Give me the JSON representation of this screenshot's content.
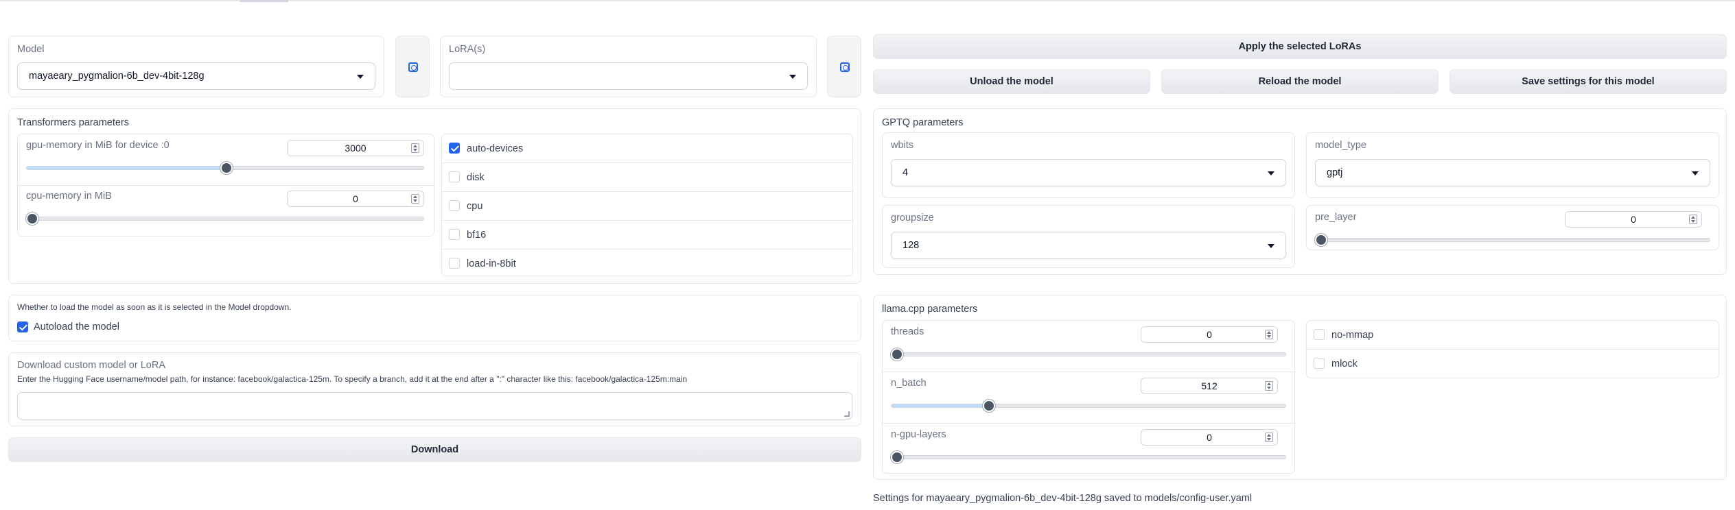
{
  "model": {
    "label": "Model",
    "selected": "mayaeary_pygmalion-6b_dev-4bit-128g"
  },
  "lora": {
    "label": "LoRA(s)",
    "selected": ""
  },
  "buttons": {
    "apply_loras": "Apply the selected LoRAs",
    "unload": "Unload the model",
    "reload": "Reload the model",
    "save_settings": "Save settings for this model",
    "download": "Download"
  },
  "transformers": {
    "title": "Transformers parameters",
    "gpu_memory": {
      "label": "gpu-memory in MiB for device :0",
      "value": "3000",
      "level": 0.5
    },
    "cpu_memory": {
      "label": "cpu-memory in MiB",
      "value": "0",
      "level": 0
    },
    "checkboxes": [
      {
        "label": "auto-devices",
        "checked": true
      },
      {
        "label": "disk",
        "checked": false
      },
      {
        "label": "cpu",
        "checked": false
      },
      {
        "label": "bf16",
        "checked": false
      },
      {
        "label": "load-in-8bit",
        "checked": false
      }
    ]
  },
  "autoload": {
    "info": "Whether to load the model as soon as it is selected in the Model dropdown.",
    "label": "Autoload the model",
    "checked": true
  },
  "download": {
    "title": "Download custom model or LoRA",
    "info": "Enter the Hugging Face username/model path, for instance: facebook/galactica-125m. To specify a branch, add it at the end after a \":\" character like this: facebook/galactica-125m:main",
    "value": ""
  },
  "gptq": {
    "title": "GPTQ parameters",
    "wbits": {
      "label": "wbits",
      "value": "4"
    },
    "model_type": {
      "label": "model_type",
      "value": "gptj"
    },
    "groupsize": {
      "label": "groupsize",
      "value": "128"
    },
    "pre_layer": {
      "label": "pre_layer",
      "value": "0",
      "level": 0
    }
  },
  "llama": {
    "title": "llama.cpp parameters",
    "threads": {
      "label": "threads",
      "value": "0",
      "level": 0
    },
    "n_batch": {
      "label": "n_batch",
      "value": "512",
      "level": 0.25
    },
    "n_gpu_layers": {
      "label": "n-gpu-layers",
      "value": "0",
      "level": 0
    },
    "checkboxes": [
      {
        "label": "no-mmap",
        "checked": false
      },
      {
        "label": "mlock",
        "checked": false
      }
    ]
  },
  "status": "Settings for mayaeary_pygmalion-6b_dev-4bit-128g saved to models/config-user.yaml",
  "colors": {
    "accent": "#2563eb",
    "slider_fill": "#bfdbfe",
    "button_bg": "#e5e7eb"
  },
  "icons": {
    "refresh": "refresh-icon"
  }
}
